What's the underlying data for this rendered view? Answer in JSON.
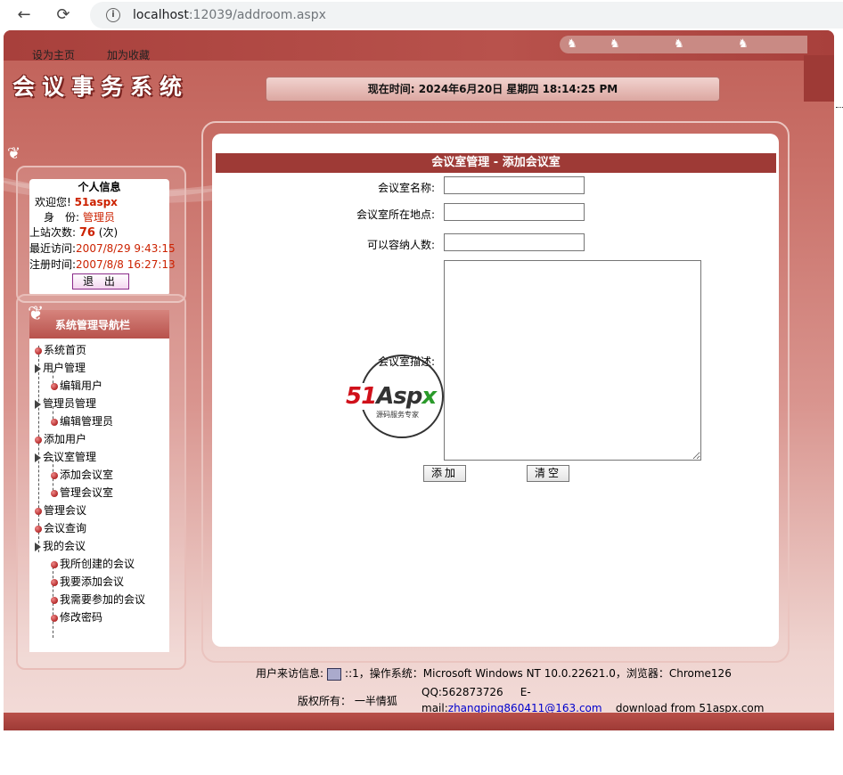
{
  "browser": {
    "url_host": "localhost",
    "url_path": ":12039/addroom.aspx",
    "back_glyph": "←",
    "reload_glyph": "⟳",
    "info_glyph": "i"
  },
  "header": {
    "link_home": "设为主页",
    "link_fav": "加为收藏",
    "system_title": "会议事务系统",
    "time_label": "现在时间:",
    "time_value": "2024年6月20日 星期四 18:14:25 PM",
    "deer_glyph": "♞"
  },
  "user_panel": {
    "title": "个人信息",
    "welcome_label": "欢迎您!",
    "welcome_value": "51aspx",
    "role_label": "身　份:",
    "role_value": "管理员",
    "visits_label": "上站次数:",
    "visits_value": "76",
    "visits_unit": "(次)",
    "last_visit_label": "最近访问:",
    "last_visit_value": "2007/8/29 9:43:15",
    "register_label": "注册时间:",
    "register_value": "2007/8/8 16:27:13",
    "logout_label": "退 出"
  },
  "nav": {
    "title": "系统管理导航栏",
    "items": [
      {
        "label": "系统首页"
      },
      {
        "label": "用户管理"
      },
      {
        "label": "编辑用户"
      },
      {
        "label": "管理员管理"
      },
      {
        "label": "编辑管理员"
      },
      {
        "label": "添加用户"
      },
      {
        "label": "会议室管理"
      },
      {
        "label": "添加会议室"
      },
      {
        "label": "管理会议室"
      },
      {
        "label": "管理会议"
      },
      {
        "label": "会议查询"
      },
      {
        "label": "我的会议"
      },
      {
        "label": "我所创建的会议"
      },
      {
        "label": "我要添加会议"
      },
      {
        "label": "我需要参加的会议"
      },
      {
        "label": "修改密码"
      }
    ]
  },
  "main": {
    "title": "会议室管理 - 添加会议室",
    "fields": {
      "name_label": "会议室名称:",
      "location_label": "会议室所在地点:",
      "capacity_label": "可以容纳人数:",
      "desc_label": "会议室描述:",
      "name_value": "",
      "location_value": "",
      "capacity_value": "",
      "desc_value": ""
    },
    "add_button": "添加",
    "clear_button": "清空"
  },
  "watermark": {
    "brand_51": "51",
    "brand_asp": "Asp",
    "brand_x": "x",
    "sub": "源码服务专家"
  },
  "footer": {
    "visitor_label": "用户来访信息:",
    "visitor_info": "::1，操作系统：Microsoft Windows NT 10.0.22621.0，浏览器：Chrome126",
    "copyright_label": "版权所有：",
    "copyright_owner": "一半情狐",
    "qq": "QQ:562873726",
    "email_label": "E-mail:",
    "email": "zhangping860411@163.com",
    "download": "download from 51aspx.com"
  }
}
